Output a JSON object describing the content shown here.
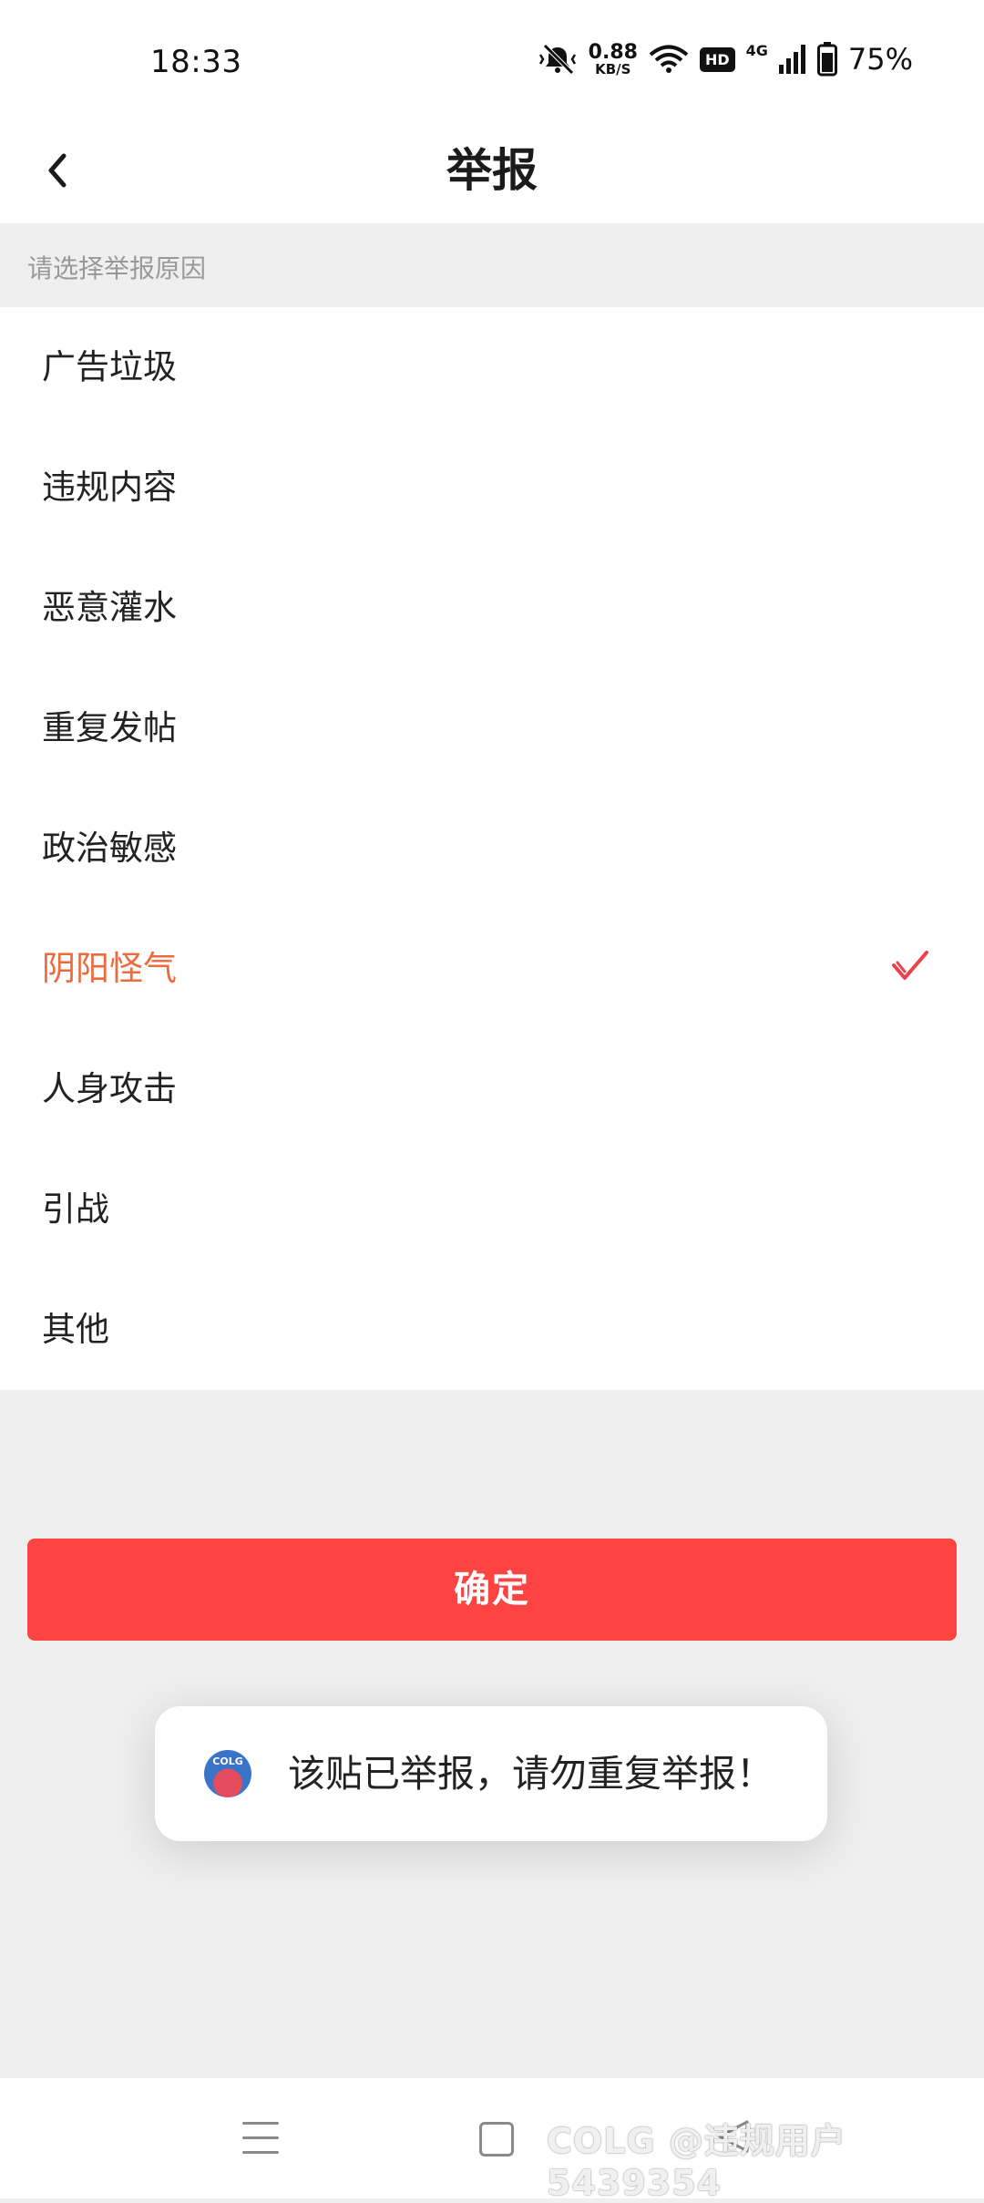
{
  "status_bar": {
    "time": "18:33",
    "net_speed": "0.88",
    "net_unit": "KB/S",
    "hd": "HD",
    "signal": "4G",
    "battery": "75%"
  },
  "header": {
    "title": "举报"
  },
  "hint": "请选择举报原因",
  "reasons": [
    {
      "label": "广告垃圾",
      "selected": false
    },
    {
      "label": "违规内容",
      "selected": false
    },
    {
      "label": "恶意灌水",
      "selected": false
    },
    {
      "label": "重复发帖",
      "selected": false
    },
    {
      "label": "政治敏感",
      "selected": false
    },
    {
      "label": "阴阳怪气",
      "selected": true
    },
    {
      "label": "人身攻击",
      "selected": false
    },
    {
      "label": "引战",
      "selected": false
    },
    {
      "label": "其他",
      "selected": false
    }
  ],
  "confirm_label": "确定",
  "toast": {
    "logo_text": "COLG",
    "message": "该贴已举报，请勿重复举报！"
  },
  "watermark": "COLG @违规用户5439354",
  "colors": {
    "accent": "#fe4343",
    "selected_text": "#ed6a3d",
    "check": "#e8424a"
  }
}
